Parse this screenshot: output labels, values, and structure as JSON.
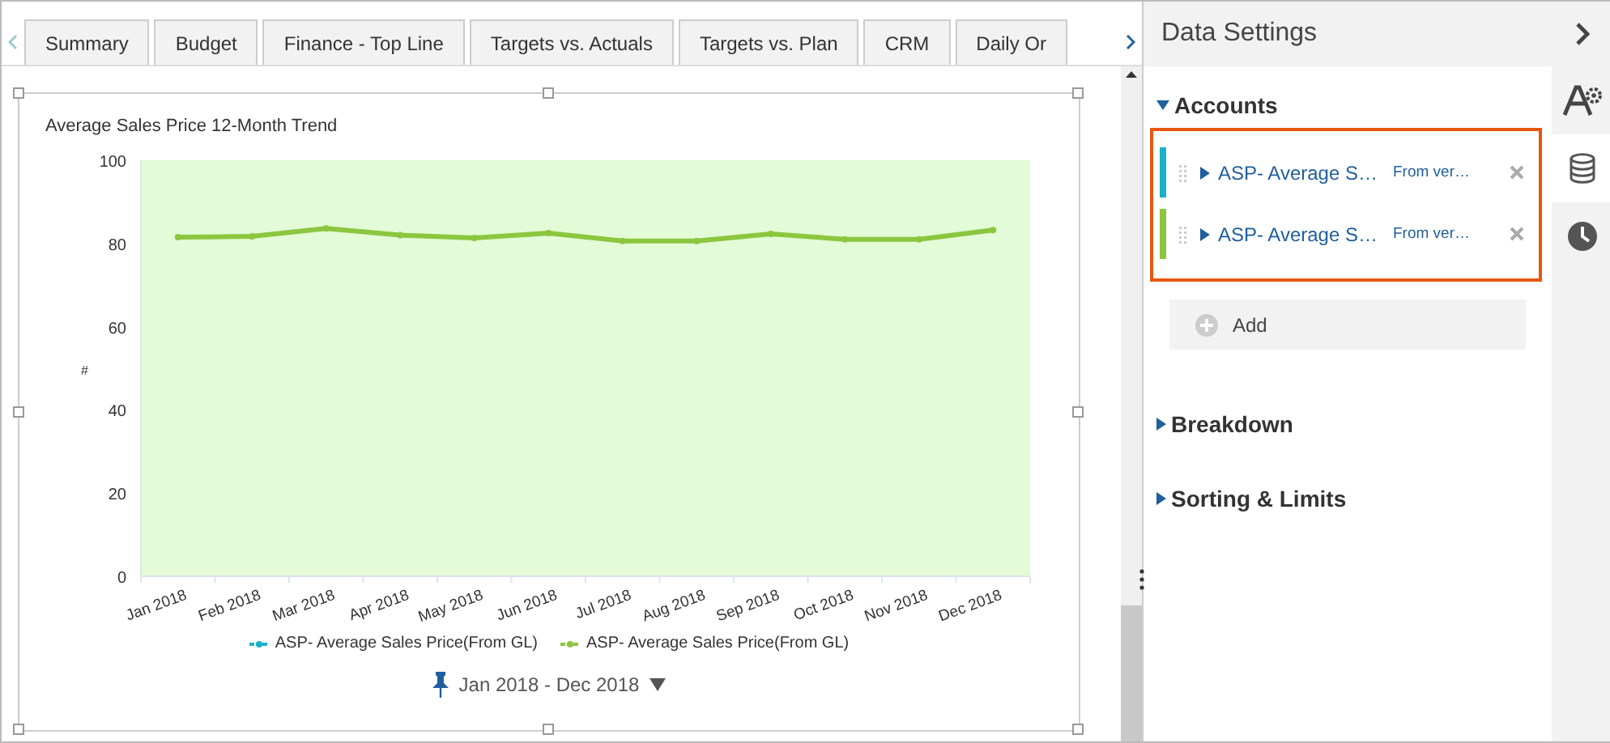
{
  "tabs": [
    {
      "label": "Summary"
    },
    {
      "label": "Budget"
    },
    {
      "label": "Finance - Top Line"
    },
    {
      "label": "Targets vs. Actuals"
    },
    {
      "label": "Targets vs. Plan"
    },
    {
      "label": "CRM"
    },
    {
      "label": "Daily Or"
    }
  ],
  "widget": {
    "chart_data": {
      "type": "line",
      "title": "Average Sales Price 12-Month Trend",
      "ylabel": "#",
      "categories": [
        "Jan 2018",
        "Feb 2018",
        "Mar 2018",
        "Apr 2018",
        "May 2018",
        "Jun 2018",
        "Jul 2018",
        "Aug 2018",
        "Sep 2018",
        "Oct 2018",
        "Nov 2018",
        "Dec 2018"
      ],
      "ylim": [
        0,
        100
      ],
      "yticks": [
        0,
        20,
        40,
        60,
        80,
        100
      ],
      "series": [
        {
          "name": "ASP- Average Sales Price(From GL)",
          "color": "#1ab0c8",
          "marker": "circle",
          "values": [
            null,
            null,
            null,
            null,
            null,
            null,
            null,
            null,
            null,
            null,
            null,
            null
          ]
        },
        {
          "name": "ASP- Average Sales Price(From GL)",
          "color": "#8cc63f",
          "marker": "circle",
          "values": [
            81.5,
            81.7,
            83.6,
            82,
            81.3,
            82.5,
            80.6,
            80.6,
            82.3,
            81,
            81,
            83.2
          ]
        }
      ]
    },
    "date_range": "Jan 2018 - Dec 2018"
  },
  "panel": {
    "title": "Data Settings",
    "sections": [
      {
        "title": "Accounts",
        "expanded": true,
        "items": [
          {
            "name": "ASP- Average S…",
            "source": "From ver…",
            "color": "#1ab0c8"
          },
          {
            "name": "ASP- Average S…",
            "source": "From ver…",
            "color": "#8cc63f"
          }
        ],
        "add_label": "Add"
      },
      {
        "title": "Breakdown",
        "expanded": false
      },
      {
        "title": "Sorting & Limits",
        "expanded": false
      }
    ],
    "side_tabs": [
      {
        "kind": "format",
        "selected": false
      },
      {
        "kind": "data",
        "selected": true
      },
      {
        "kind": "schedule",
        "selected": false
      }
    ]
  }
}
